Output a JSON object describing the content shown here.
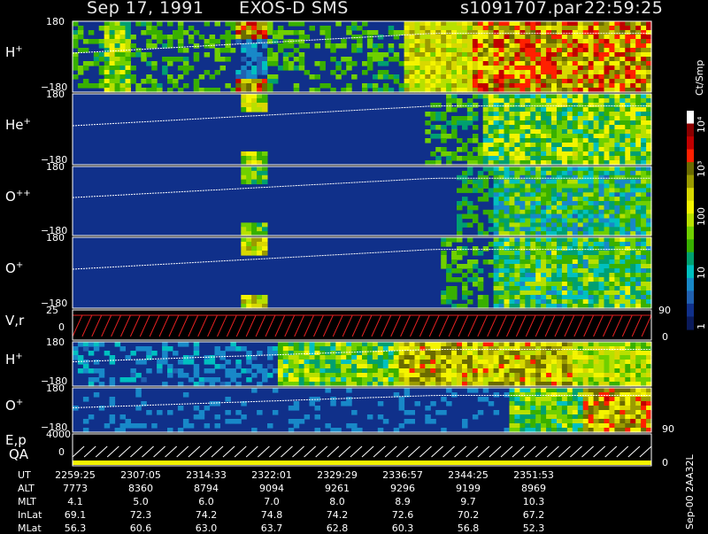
{
  "header": {
    "date": "Sep 17, 1991",
    "instrument": "EXOS-D SMS",
    "file": "s1091707.par",
    "time": "22:59:25"
  },
  "colorbar": {
    "unit_label": "Ct/Smp",
    "ticks": [
      "10⁴",
      "10³",
      "100",
      "10",
      "1"
    ],
    "colors": [
      "#ffffff",
      "#8b0000",
      "#c00000",
      "#ff2000",
      "#6b6b00",
      "#9b9b00",
      "#d8d800",
      "#f4f400",
      "#b8e000",
      "#70d000",
      "#38b000",
      "#00a070",
      "#00c0c0",
      "#1888c8",
      "#2060b0",
      "#10308a",
      "#0a1a5a"
    ]
  },
  "panels": [
    {
      "label": "H",
      "charge": "+",
      "ymax": "180",
      "ymin": "−180"
    },
    {
      "label": "He",
      "charge": "+",
      "ymax": "180",
      "ymin": "−180"
    },
    {
      "label": "O",
      "charge": "++",
      "ymax": "180",
      "ymin": "−180"
    },
    {
      "label": "O",
      "charge": "+",
      "ymax": "180",
      "ymin": "−180"
    },
    {
      "label": "V,r",
      "charge": "",
      "ymax": "25",
      "ymid": "0",
      "right_top": "90",
      "right_bottom": "0"
    },
    {
      "label": "H",
      "charge": "+",
      "ymax": "180",
      "ymin": "−180"
    },
    {
      "label": "O",
      "charge": "+",
      "ymax": "180",
      "ymin": "−180",
      "right_bottom": "90"
    },
    {
      "label": "E,p",
      "label2": "QA",
      "ymax": "4000",
      "ymid": "0",
      "right_bottom": "0"
    }
  ],
  "footer": {
    "keys": [
      "UT",
      "ALT",
      "MLT",
      "InLat",
      "MLat"
    ],
    "columns": [
      {
        "UT": "2259:25",
        "ALT": "7773",
        "MLT": "4.1",
        "InLat": "69.1",
        "MLat": "56.3"
      },
      {
        "UT": "2307:05",
        "ALT": "8360",
        "MLT": "5.0",
        "InLat": "72.3",
        "MLat": "60.6"
      },
      {
        "UT": "2314:33",
        "ALT": "8794",
        "MLT": "6.0",
        "InLat": "74.2",
        "MLat": "63.0"
      },
      {
        "UT": "2322:01",
        "ALT": "9094",
        "MLT": "7.0",
        "InLat": "74.8",
        "MLat": "63.7"
      },
      {
        "UT": "2329:29",
        "ALT": "9261",
        "MLT": "8.0",
        "InLat": "74.2",
        "MLat": "62.8"
      },
      {
        "UT": "2336:57",
        "ALT": "9296",
        "MLT": "8.9",
        "InLat": "72.6",
        "MLat": "60.3"
      },
      {
        "UT": "2344:25",
        "ALT": "9199",
        "MLT": "9.7",
        "InLat": "70.2",
        "MLat": "56.8"
      },
      {
        "UT": "2351:53",
        "ALT": "8969",
        "MLT": "10.3",
        "InLat": "67.2",
        "MLat": "52.3"
      }
    ]
  },
  "side_note": "Sep-00 2AA32L",
  "chart_data": {
    "type": "heatmap",
    "x_ticks": [
      "2259:25",
      "2307:05",
      "2314:33",
      "2322:01",
      "2329:29",
      "2336:57",
      "2344:25",
      "2351:53"
    ],
    "y_range_pitch": [
      -180,
      180
    ],
    "colorbar_range": [
      1,
      10000
    ],
    "log_colorbar": true,
    "unit": "Ct/Smp"
  }
}
